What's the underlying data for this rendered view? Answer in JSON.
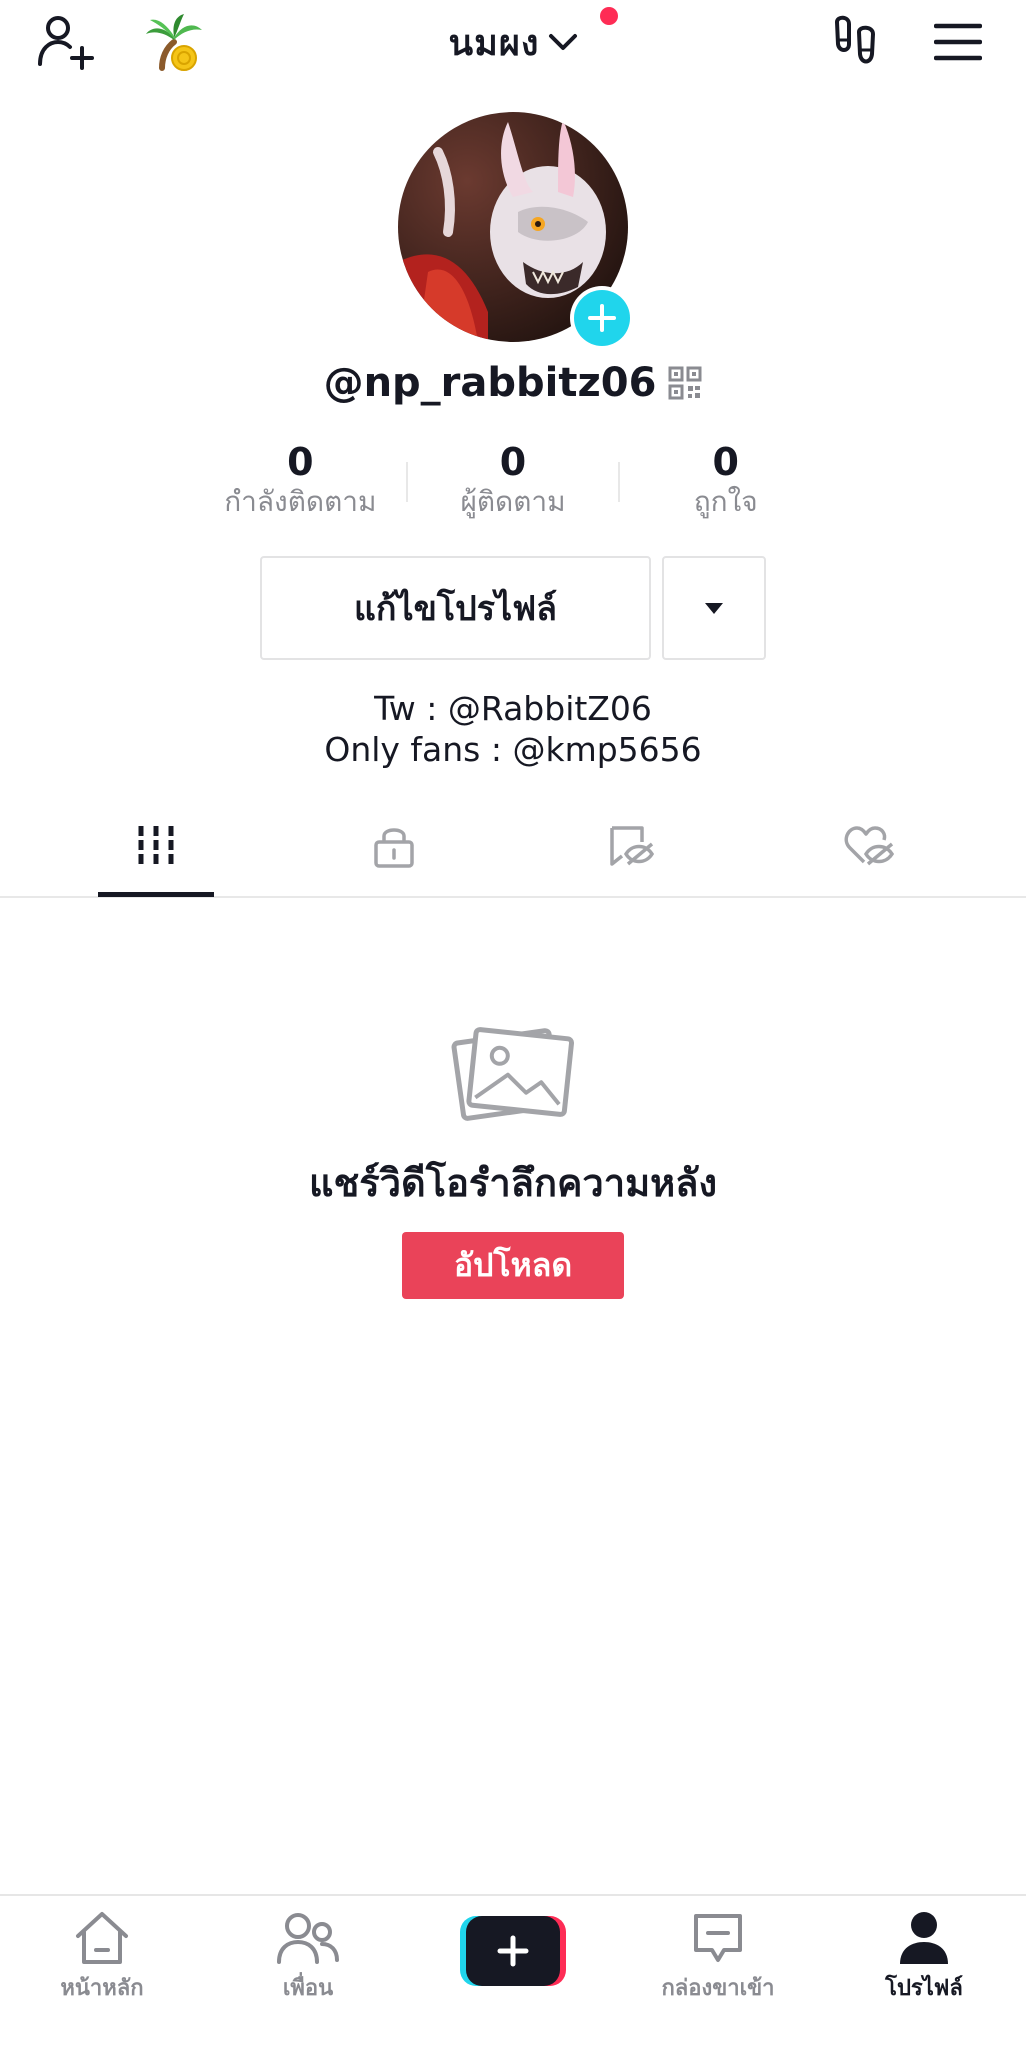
{
  "header": {
    "account_name": "นมผง",
    "icons": [
      "add-user-icon",
      "coin-palm-icon",
      "chevron-down-icon",
      "footprints-icon",
      "menu-icon"
    ]
  },
  "profile": {
    "username": "@np_rabbitz06",
    "stats": [
      {
        "value": "0",
        "label": "กำลังติดตาม"
      },
      {
        "value": "0",
        "label": "ผู้ติดตาม"
      },
      {
        "value": "0",
        "label": "ถูกใจ"
      }
    ],
    "edit_label": "แก้ไขโปรไฟล์",
    "bio_line1": "Tw : @RabbitZ06",
    "bio_line2": "Only fans : @kmp5656"
  },
  "tabs": [
    {
      "icon": "grid-icon",
      "active": true
    },
    {
      "icon": "lock-icon",
      "active": false
    },
    {
      "icon": "bookmark-hidden-icon",
      "active": false
    },
    {
      "icon": "heart-hidden-icon",
      "active": false
    }
  ],
  "empty_state": {
    "title": "แชร์วิดีโอรำลึกความหลัง",
    "button_label": "อัปโหลด"
  },
  "bottom_nav": [
    {
      "label": "หน้าหลัก",
      "icon": "home-icon"
    },
    {
      "label": "เพื่อน",
      "icon": "friends-icon"
    },
    {
      "label": "",
      "icon": "plus-icon"
    },
    {
      "label": "กล่องขาเข้า",
      "icon": "inbox-icon"
    },
    {
      "label": "โปรไฟล์",
      "icon": "profile-icon",
      "active": true
    }
  ],
  "colors": {
    "accent": "#ea4359",
    "notification": "#fe2c55",
    "avatar_add": "#20d5ec",
    "text_primary": "#161823",
    "text_secondary": "#8a8b91"
  }
}
